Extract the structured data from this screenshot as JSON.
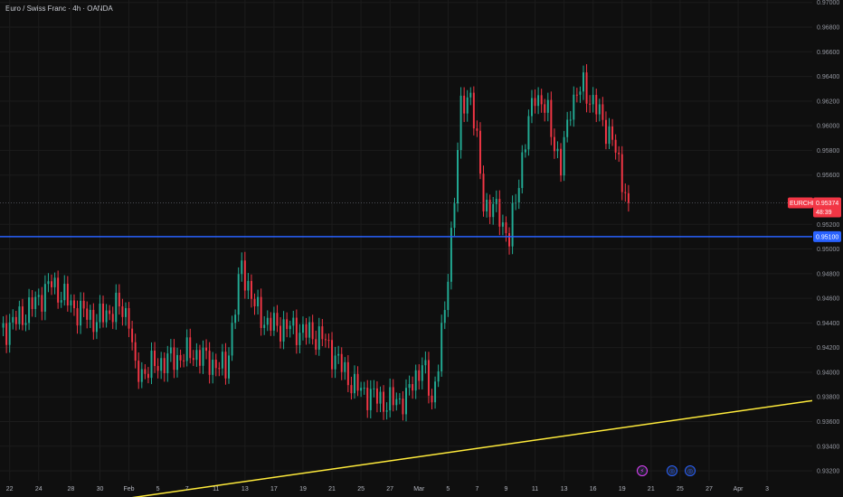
{
  "header": {
    "title": "Euro / Swiss Franc · 4h · OANDA"
  },
  "colors": {
    "background": "#0f0f0f",
    "grid": "#1c1c1c",
    "up": "#22ab94",
    "down": "#f23645",
    "support_line": "#2962ff",
    "trend_line": "#ffeb3b",
    "price_badge": "#f23645",
    "level_badge": "#2962ff"
  },
  "chart_data": {
    "type": "candlestick",
    "symbol": "EURCHF",
    "timeframe": "4h",
    "y_axis": {
      "ylim": [
        0.9312,
        0.9702
      ],
      "ticks": [
        "0.97000",
        "0.96800",
        "0.96600",
        "0.96400",
        "0.96200",
        "0.96000",
        "0.95800",
        "0.95600",
        "0.95200",
        "0.95000",
        "0.94800",
        "0.94600",
        "0.94400",
        "0.94200",
        "0.94000",
        "0.93800",
        "0.93600",
        "0.93400",
        "0.93200"
      ],
      "tick_values": [
        0.97,
        0.968,
        0.966,
        0.964,
        0.962,
        0.96,
        0.958,
        0.956,
        0.952,
        0.95,
        0.948,
        0.946,
        0.944,
        0.942,
        0.94,
        0.938,
        0.936,
        0.934,
        0.932
      ]
    },
    "x_axis": {
      "ticks": [
        "22",
        "24",
        "28",
        "30",
        "Feb",
        "5",
        "7",
        "11",
        "13",
        "17",
        "19",
        "21",
        "25",
        "27",
        "Mar",
        "5",
        "7",
        "9",
        "11",
        "13",
        "16",
        "19",
        "21",
        "25",
        "27",
        "Apr",
        "3"
      ],
      "tick_index": [
        3,
        12,
        22,
        31,
        40,
        49,
        58,
        67,
        76,
        85,
        94,
        103,
        112,
        121,
        130,
        139,
        148,
        157,
        166,
        175,
        184,
        193,
        202,
        211,
        220,
        229,
        238
      ],
      "x_range": [
        0,
        252
      ]
    },
    "last_price": {
      "label": "EURCHF",
      "value": "0.95374",
      "countdown": "48:39",
      "y": 0.95374
    },
    "horizontal_levels": [
      {
        "label": "0.95100",
        "y": 0.951
      }
    ],
    "trend_lines": [
      {
        "x": [
          0,
          252
        ],
        "y": [
          0.9283,
          0.9377
        ]
      }
    ],
    "event_markers": [
      "⚡",
      "◎",
      "◎"
    ],
    "series_anchors": {
      "index": [
        0,
        8,
        16,
        23,
        30,
        36,
        40,
        42,
        50,
        60,
        70,
        75,
        79,
        83,
        90,
        100,
        110,
        120,
        126,
        131,
        134,
        138,
        143,
        146,
        150,
        155,
        158,
        162,
        166,
        170,
        174,
        177,
        181,
        186,
        190,
        195
      ],
      "close": [
        0.9432,
        0.9448,
        0.9472,
        0.9452,
        0.9442,
        0.9453,
        0.9446,
        0.9398,
        0.9408,
        0.9416,
        0.9402,
        0.9487,
        0.9453,
        0.9439,
        0.9436,
        0.9428,
        0.9388,
        0.9375,
        0.9379,
        0.9408,
        0.9375,
        0.9447,
        0.9612,
        0.9628,
        0.9538,
        0.9528,
        0.9507,
        0.9574,
        0.9628,
        0.9608,
        0.9565,
        0.9618,
        0.9632,
        0.9609,
        0.9588,
        0.9538
      ]
    }
  }
}
